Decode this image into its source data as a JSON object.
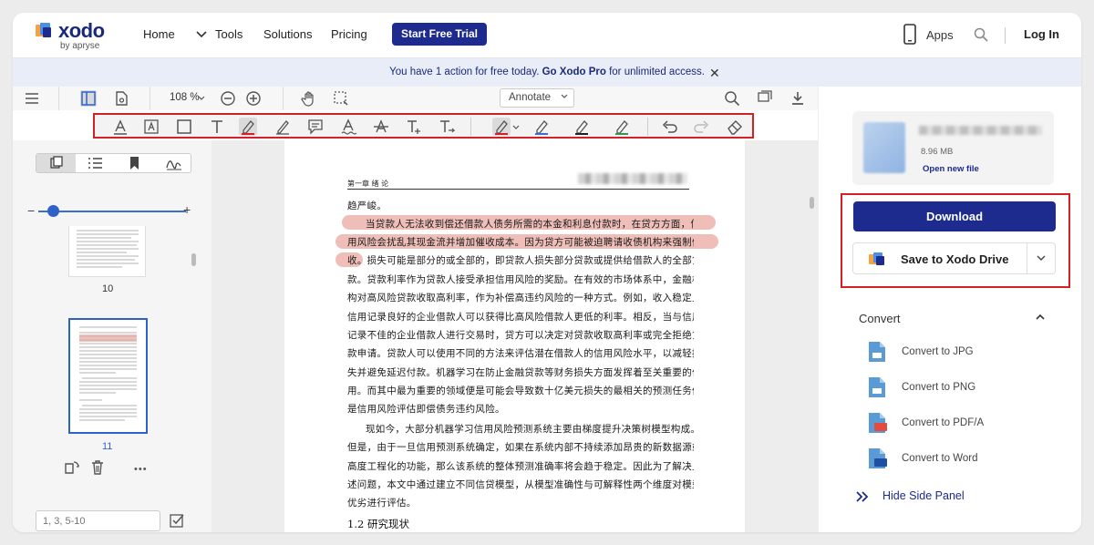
{
  "nav": {
    "logo_word": "xodo",
    "logo_sub": "by apryse",
    "home": "Home",
    "tools": "Tools",
    "solutions": "Solutions",
    "pricing": "Pricing",
    "trial": "Start Free Trial",
    "apps": "Apps",
    "login": "Log In"
  },
  "banner": {
    "pre": "You have ",
    "count": "1",
    "mid": " action for free today. ",
    "cta": "Go Xodo Pro",
    "post": " for unlimited access.",
    "close": "✕"
  },
  "toolbar": {
    "zoom": "108 %",
    "mode": "Annotate"
  },
  "thumbs": {
    "page_10": "10",
    "page_11": "11",
    "range_placeholder": "1, 3, 5-10",
    "more": "•••",
    "minus": "−",
    "plus": "+"
  },
  "document": {
    "running_head": "第一章 绪  论",
    "lines": [
      "趋严峻。",
      "当贷款人无法收到偿还借款人债务所需的本金和利息付款时，在贷方方面，信",
      "用风险会扰乱其现金流并增加催收成本。因为贷方可能被迫聘请收债机构来强制催",
      "收。损失可能是部分的或全部的，即贷款人损失部分贷款或提供给借款人的全部贷",
      "款。贷款利率作为贷款人接受承担信用风险的奖励。在有效的市场体系中，金融机",
      "构对高风险贷款收取高利率，作为补偿高违约风险的一种方式。例如，收入稳定且",
      "信用记录良好的企业借款人可以获得比高风险借款人更低的利率。相反，当与信用",
      "记录不佳的企业借款人进行交易时，贷方可以决定对贷款收取高利率或完全拒绝贷",
      "款申请。贷款人可以使用不同的方法来评估潜在借款人的信用风险水平，以减轻损",
      "失并避免延迟付款。机器学习在防止金融贷款等财务损失方面发挥着至关重要的作",
      "用。而其中最为重要的领域便是可能会导致数十亿美元损失的最相关的预测任务便",
      "是信用风险评估即偿债务违约风险。",
      "现如今，大部分机器学习信用风险预测系统主要由梯度提升决策树模型构成。",
      "但是，由于一旦信用预测系统确定，如果在系统内部不持续添加昂贵的新数据源或",
      "高度工程化的功能，那么该系统的整体预测准确率将会趋于稳定。因此为了解决上",
      "述问题，本文中通过建立不同信贷模型，从模型准确性与可解释性两个维度对模型",
      "优劣进行评估。"
    ],
    "section_heading": "1.2 研究现状"
  },
  "side": {
    "file_size": "8.96 MB",
    "open_file": "Open new file",
    "download": "Download",
    "save_drive": "Save to Xodo Drive",
    "convert_title": "Convert",
    "convert_items": [
      "Convert to JPG",
      "Convert to PNG",
      "Convert to PDF/A",
      "Convert to Word"
    ],
    "hide_panel": "Hide Side Panel"
  },
  "colors": {
    "brand_navy": "#1d2a8e",
    "highlight_red": "#d62027",
    "banner_bg": "#e8edf8",
    "text_highlight": "#e9a8a0",
    "accent_blue": "#2f62c9"
  }
}
